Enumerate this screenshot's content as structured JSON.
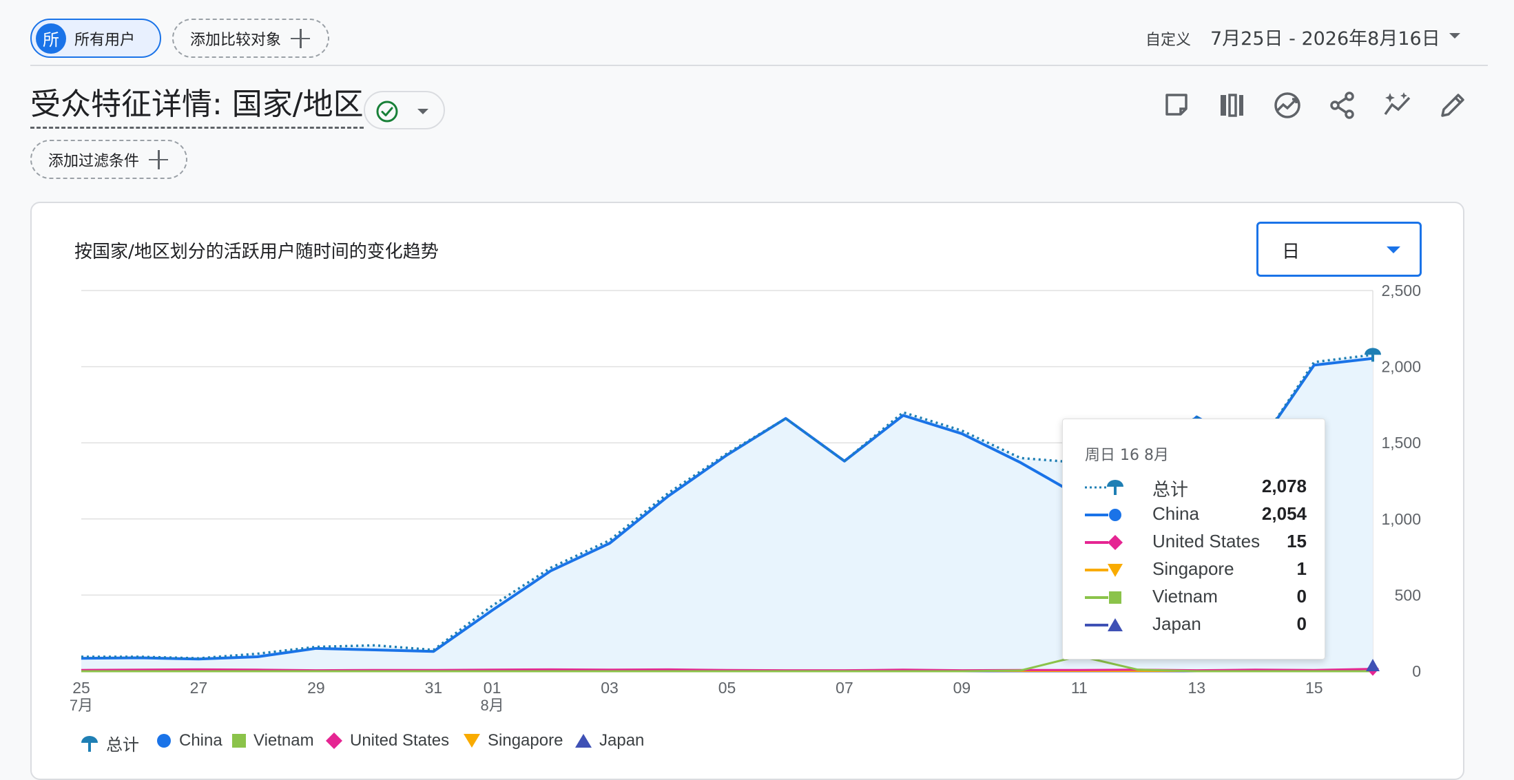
{
  "header": {
    "segment_avatar": "所",
    "segment_label": "所有用户",
    "compare_label": "添加比较对象",
    "date_mode": "自定义",
    "date_range": "7月25日 - 2026年8月16日"
  },
  "page": {
    "title": "受众特征详情: 国家/地区",
    "filter_label": "添加过滤条件"
  },
  "toolbar": {
    "icons": [
      "notes-icon",
      "compare-columns-icon",
      "insights-icon",
      "share-icon",
      "sparkle-trend-icon",
      "edit-icon"
    ]
  },
  "card": {
    "title": "按国家/地区划分的活跃用户随时间的变化趋势",
    "granularity": "日"
  },
  "tooltip": {
    "date": "周日 16 8月",
    "rows": [
      {
        "name": "总计",
        "value": "2,078"
      },
      {
        "name": "China",
        "value": "2,054"
      },
      {
        "name": "United States",
        "value": "15"
      },
      {
        "name": "Singapore",
        "value": "1"
      },
      {
        "name": "Vietnam",
        "value": "0"
      },
      {
        "name": "Japan",
        "value": "0"
      }
    ]
  },
  "colors": {
    "total": "#1f7fb4",
    "china": "#1a73e8",
    "united_states": "#e52592",
    "singapore": "#f9ab00",
    "vietnam": "#8bc34a",
    "japan": "#3f51b5",
    "area": "#e8f4fd"
  },
  "chart_data": {
    "type": "line",
    "x": [
      "07-25",
      "07-26",
      "07-27",
      "07-28",
      "07-29",
      "07-30",
      "07-31",
      "08-01",
      "08-02",
      "08-03",
      "08-04",
      "08-05",
      "08-06",
      "08-07",
      "08-08",
      "08-09",
      "08-10",
      "08-11",
      "08-12",
      "08-13",
      "08-14",
      "08-15",
      "08-16"
    ],
    "x_tick_labels": [
      {
        "day": "25",
        "month": "7月",
        "index": 0
      },
      {
        "day": "27",
        "index": 2
      },
      {
        "day": "29",
        "index": 4
      },
      {
        "day": "31",
        "index": 6
      },
      {
        "day": "01",
        "month": "8月",
        "index": 7
      },
      {
        "day": "03",
        "index": 9
      },
      {
        "day": "05",
        "index": 11
      },
      {
        "day": "07",
        "index": 13
      },
      {
        "day": "09",
        "index": 15
      },
      {
        "day": "11",
        "index": 17
      },
      {
        "day": "13",
        "index": 19
      },
      {
        "day": "15",
        "index": 21
      }
    ],
    "y_ticks": [
      "0",
      "500",
      "1,000",
      "1,500",
      "2,000",
      "2,500"
    ],
    "ylim": [
      0,
      2500
    ],
    "grid": true,
    "legend_position": "bottom-left",
    "series": [
      {
        "name": "总计",
        "key": "total",
        "style": "dotted",
        "values": [
          95,
          95,
          85,
          115,
          160,
          170,
          140,
          430,
          680,
          860,
          1170,
          1430,
          1660,
          1380,
          1700,
          1580,
          1400,
          1370,
          1410,
          1670,
          1450,
          2030,
          2078
        ]
      },
      {
        "name": "China",
        "key": "china",
        "style": "solid",
        "values": [
          85,
          88,
          80,
          95,
          150,
          140,
          130,
          400,
          660,
          840,
          1150,
          1420,
          1660,
          1380,
          1680,
          1560,
          1370,
          1150,
          1310,
          1670,
          1450,
          2010,
          2054
        ]
      },
      {
        "name": "Vietnam",
        "key": "vietnam",
        "style": "solid",
        "values": [
          0,
          0,
          0,
          0,
          0,
          0,
          0,
          0,
          0,
          0,
          0,
          0,
          0,
          0,
          0,
          0,
          5,
          100,
          10,
          0,
          0,
          0,
          0
        ]
      },
      {
        "name": "United States",
        "key": "united_states",
        "style": "solid",
        "values": [
          8,
          10,
          12,
          10,
          6,
          8,
          8,
          10,
          12,
          10,
          12,
          8,
          6,
          6,
          10,
          6,
          8,
          8,
          10,
          6,
          10,
          8,
          15
        ]
      },
      {
        "name": "Singapore",
        "key": "singapore",
        "style": "solid",
        "values": [
          2,
          2,
          2,
          2,
          2,
          2,
          2,
          3,
          3,
          3,
          3,
          2,
          2,
          2,
          2,
          2,
          2,
          2,
          2,
          2,
          2,
          2,
          1
        ]
      },
      {
        "name": "Japan",
        "key": "japan",
        "style": "solid",
        "values": [
          0,
          0,
          0,
          0,
          0,
          0,
          0,
          0,
          0,
          0,
          0,
          0,
          0,
          0,
          0,
          0,
          0,
          0,
          0,
          0,
          0,
          0,
          0
        ]
      }
    ]
  }
}
